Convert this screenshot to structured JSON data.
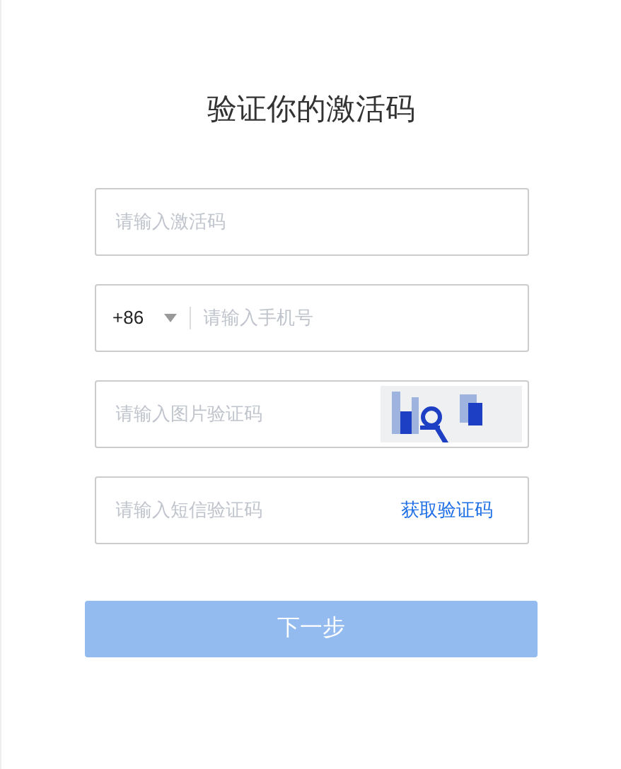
{
  "title": "验证你的激活码",
  "fields": [
    {
      "kind": "text",
      "placeholder": "请输入激活码"
    },
    {
      "kind": "phone",
      "country_code": "+86",
      "placeholder": "请输入手机号"
    },
    {
      "kind": "captcha",
      "placeholder": "请输入图片验证码"
    },
    {
      "kind": "sms",
      "placeholder": "请输入短信验证码",
      "action": "获取验证码"
    }
  ],
  "next_button": {
    "label": "下一步",
    "disabled": true
  }
}
